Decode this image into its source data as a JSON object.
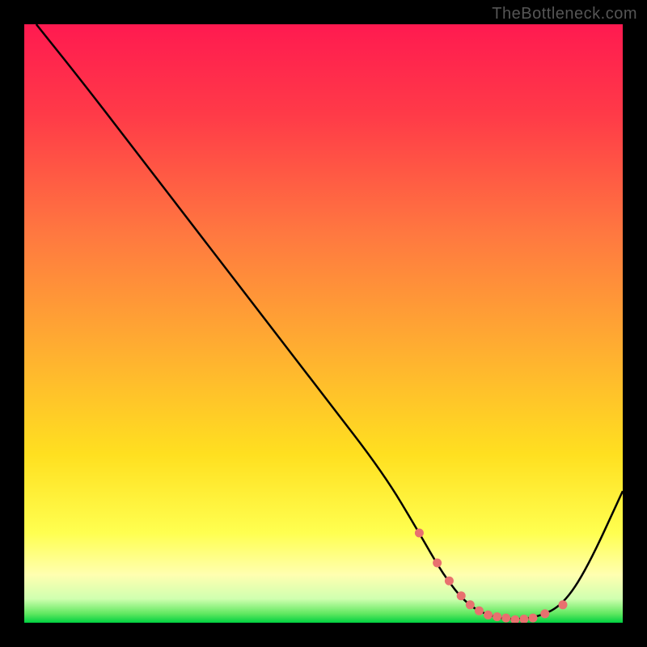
{
  "watermark": "TheBottleneck.com",
  "chart_data": {
    "type": "line",
    "title": "",
    "xlabel": "",
    "ylabel": "",
    "xlim": [
      0,
      100
    ],
    "ylim": [
      0,
      100
    ],
    "curve": {
      "x": [
        2,
        10,
        20,
        30,
        40,
        50,
        60,
        66,
        70,
        74,
        78,
        82,
        86,
        90,
        94,
        100
      ],
      "y": [
        100,
        90,
        77,
        64,
        51,
        38,
        25,
        15,
        8,
        3,
        1,
        0.5,
        1,
        3,
        9,
        22
      ]
    },
    "series": [
      {
        "name": "data-points",
        "color": "#e8716f",
        "x": [
          66,
          69,
          71,
          73,
          74.5,
          76,
          77.5,
          79,
          80.5,
          82,
          83.5,
          85,
          87,
          90
        ],
        "y": [
          15,
          10,
          7,
          4.5,
          3,
          2,
          1.3,
          1,
          0.8,
          0.5,
          0.6,
          0.8,
          1.5,
          3
        ]
      }
    ],
    "gradient_stops": [
      {
        "offset": 0,
        "color": "#ff1a50"
      },
      {
        "offset": 0.15,
        "color": "#ff3a48"
      },
      {
        "offset": 0.35,
        "color": "#ff7840"
      },
      {
        "offset": 0.55,
        "color": "#ffb030"
      },
      {
        "offset": 0.72,
        "color": "#ffe020"
      },
      {
        "offset": 0.85,
        "color": "#ffff50"
      },
      {
        "offset": 0.92,
        "color": "#ffffb0"
      },
      {
        "offset": 0.96,
        "color": "#d0ffb0"
      },
      {
        "offset": 0.985,
        "color": "#60e860"
      },
      {
        "offset": 1,
        "color": "#00d040"
      }
    ]
  }
}
